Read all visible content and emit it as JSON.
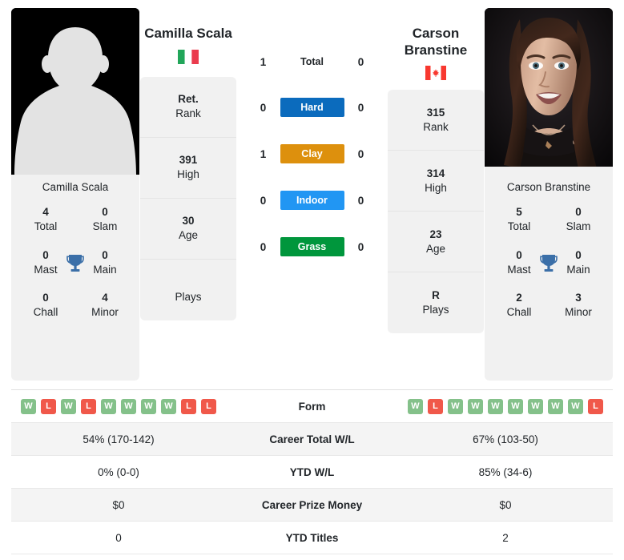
{
  "players": {
    "left": {
      "name": "Camilla Scala",
      "name_lines": [
        "Camilla Scala"
      ],
      "country": "Italy",
      "flag_icon": "flag-italy-icon",
      "photo_type": "placeholder-avatar",
      "card_name": "Camilla Scala",
      "rank_rows": [
        {
          "value": "Ret.",
          "label": "Rank"
        },
        {
          "value": "391",
          "label": "High"
        },
        {
          "value": "30",
          "label": "Age"
        },
        {
          "value": "",
          "label": "Plays"
        }
      ],
      "titles": [
        {
          "value": "4",
          "label": "Total"
        },
        {
          "value": "0",
          "label": "Slam"
        },
        {
          "value": "0",
          "label": "Mast"
        },
        {
          "value": "0",
          "label": "Main"
        },
        {
          "value": "0",
          "label": "Chall"
        },
        {
          "value": "4",
          "label": "Minor"
        }
      ],
      "form": [
        "W",
        "L",
        "W",
        "L",
        "W",
        "W",
        "W",
        "W",
        "L",
        "L"
      ],
      "stats": {
        "career_total_wl": "54% (170-142)",
        "ytd_wl": "0% (0-0)",
        "career_prize_money": "$0",
        "ytd_titles": "0"
      }
    },
    "right": {
      "name": "Carson Branstine",
      "name_lines": [
        "Carson",
        "Branstine"
      ],
      "country": "Canada",
      "flag_icon": "flag-canada-icon",
      "photo_type": "portrait-photo",
      "card_name": "Carson Branstine",
      "rank_rows": [
        {
          "value": "315",
          "label": "Rank"
        },
        {
          "value": "314",
          "label": "High"
        },
        {
          "value": "23",
          "label": "Age"
        },
        {
          "value": "R",
          "label": "Plays"
        }
      ],
      "titles": [
        {
          "value": "5",
          "label": "Total"
        },
        {
          "value": "0",
          "label": "Slam"
        },
        {
          "value": "0",
          "label": "Mast"
        },
        {
          "value": "0",
          "label": "Main"
        },
        {
          "value": "2",
          "label": "Chall"
        },
        {
          "value": "3",
          "label": "Minor"
        }
      ],
      "form": [
        "W",
        "L",
        "W",
        "W",
        "W",
        "W",
        "W",
        "W",
        "W",
        "L"
      ],
      "stats": {
        "career_total_wl": "67% (103-50)",
        "ytd_wl": "85% (34-6)",
        "career_prize_money": "$0",
        "ytd_titles": "2"
      }
    }
  },
  "head_to_head": [
    {
      "label": "Total",
      "left": "1",
      "right": "0",
      "badge": false,
      "color": ""
    },
    {
      "label": "Hard",
      "left": "0",
      "right": "0",
      "badge": true,
      "color": "#0b6bbd"
    },
    {
      "label": "Clay",
      "left": "1",
      "right": "0",
      "badge": true,
      "color": "#dd900d"
    },
    {
      "label": "Indoor",
      "left": "0",
      "right": "0",
      "badge": true,
      "color": "#2196f3"
    },
    {
      "label": "Grass",
      "left": "0",
      "right": "0",
      "badge": true,
      "color": "#00963c"
    }
  ],
  "comparison_rows": [
    {
      "key": "form",
      "label": "Form"
    },
    {
      "key": "career_total_wl",
      "label": "Career Total W/L"
    },
    {
      "key": "ytd_wl",
      "label": "YTD W/L"
    },
    {
      "key": "career_prize_money",
      "label": "Career Prize Money"
    },
    {
      "key": "ytd_titles",
      "label": "YTD Titles"
    }
  ],
  "icons": {
    "trophy": "trophy-icon"
  },
  "colors": {
    "hard": "#0b6bbd",
    "clay": "#dd900d",
    "indoor": "#2196f3",
    "grass": "#00963c",
    "win": "#84c18a",
    "loss": "#f0584a",
    "trophy": "#3b6fa8",
    "card_bg": "#f1f1f1"
  }
}
